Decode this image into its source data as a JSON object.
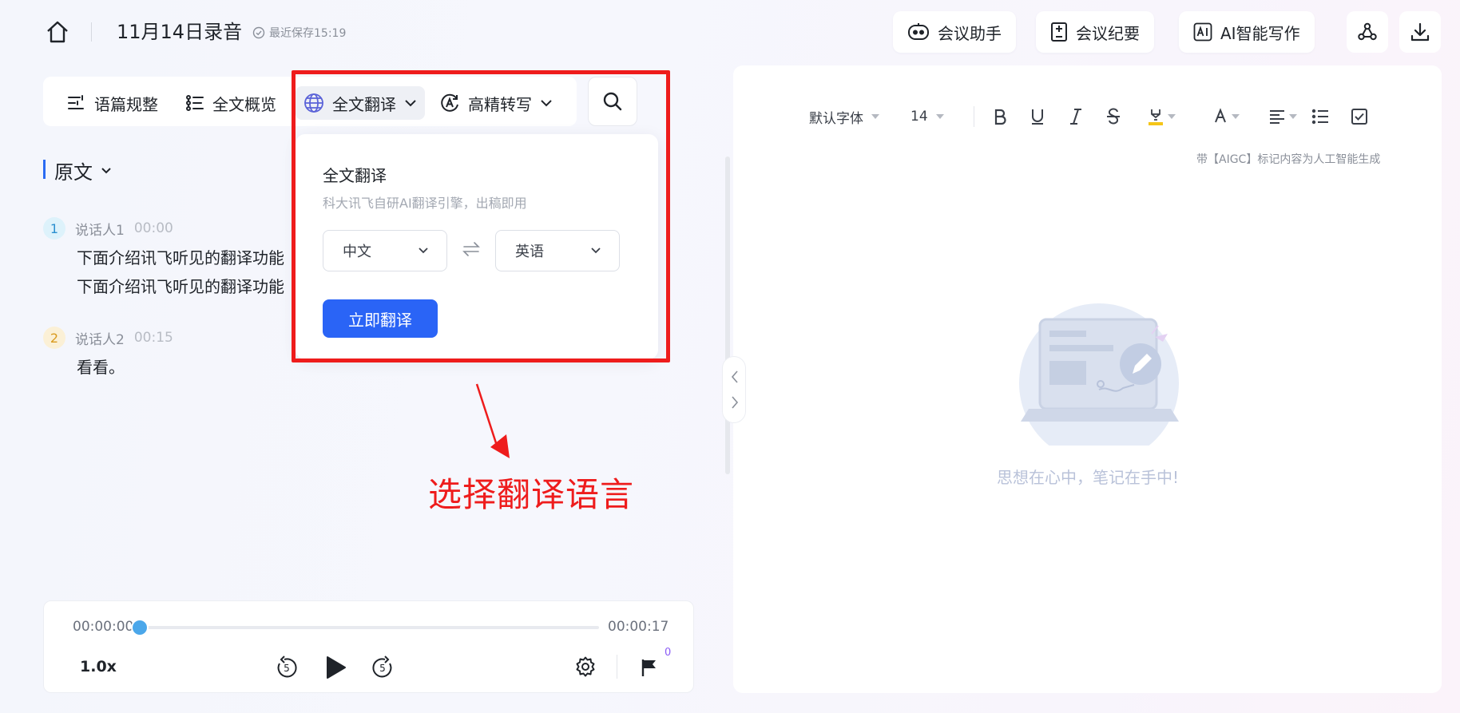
{
  "header": {
    "title": "11月14日录音",
    "save_status": "最近保存15:19",
    "buttons": {
      "assistant": "会议助手",
      "minutes": "会议纪要",
      "ai_writing": "AI智能写作"
    }
  },
  "toolbar": {
    "discourse": "语篇规整",
    "overview": "全文概览",
    "translate": "全文翻译",
    "transcribe": "高精转写"
  },
  "transcript": {
    "section_label": "原文",
    "speakers": [
      {
        "num": "1",
        "name": "说话人1",
        "time": "00:00",
        "lines": [
          "下面介绍讯飞听见的翻译功能",
          "下面介绍讯飞听见的翻译功能"
        ]
      },
      {
        "num": "2",
        "name": "说话人2",
        "time": "00:15",
        "lines": [
          "看看。"
        ]
      }
    ]
  },
  "player": {
    "current_time": "00:00:00",
    "total_time": "00:00:17",
    "progress": 0,
    "speed": "1.0x",
    "rewind_seconds": "5",
    "forward_seconds": "5",
    "flag_count": "0"
  },
  "translate_popover": {
    "title": "全文翻译",
    "subtitle": "科大讯飞自研AI翻译引擎，出稿即用",
    "source_lang": "中文",
    "target_lang": "英语",
    "submit": "立即翻译"
  },
  "annotation": "选择翻译语言",
  "editor": {
    "font": "默认字体",
    "size": "14",
    "aigc_note": "带【AIGC】标记内容为人工智能生成",
    "empty_tip": "思想在心中，笔记在手中!"
  },
  "colors": {
    "accent": "#2a64f6",
    "annotation": "#ee1c1c",
    "progress_knob": "#4ba7ea"
  }
}
